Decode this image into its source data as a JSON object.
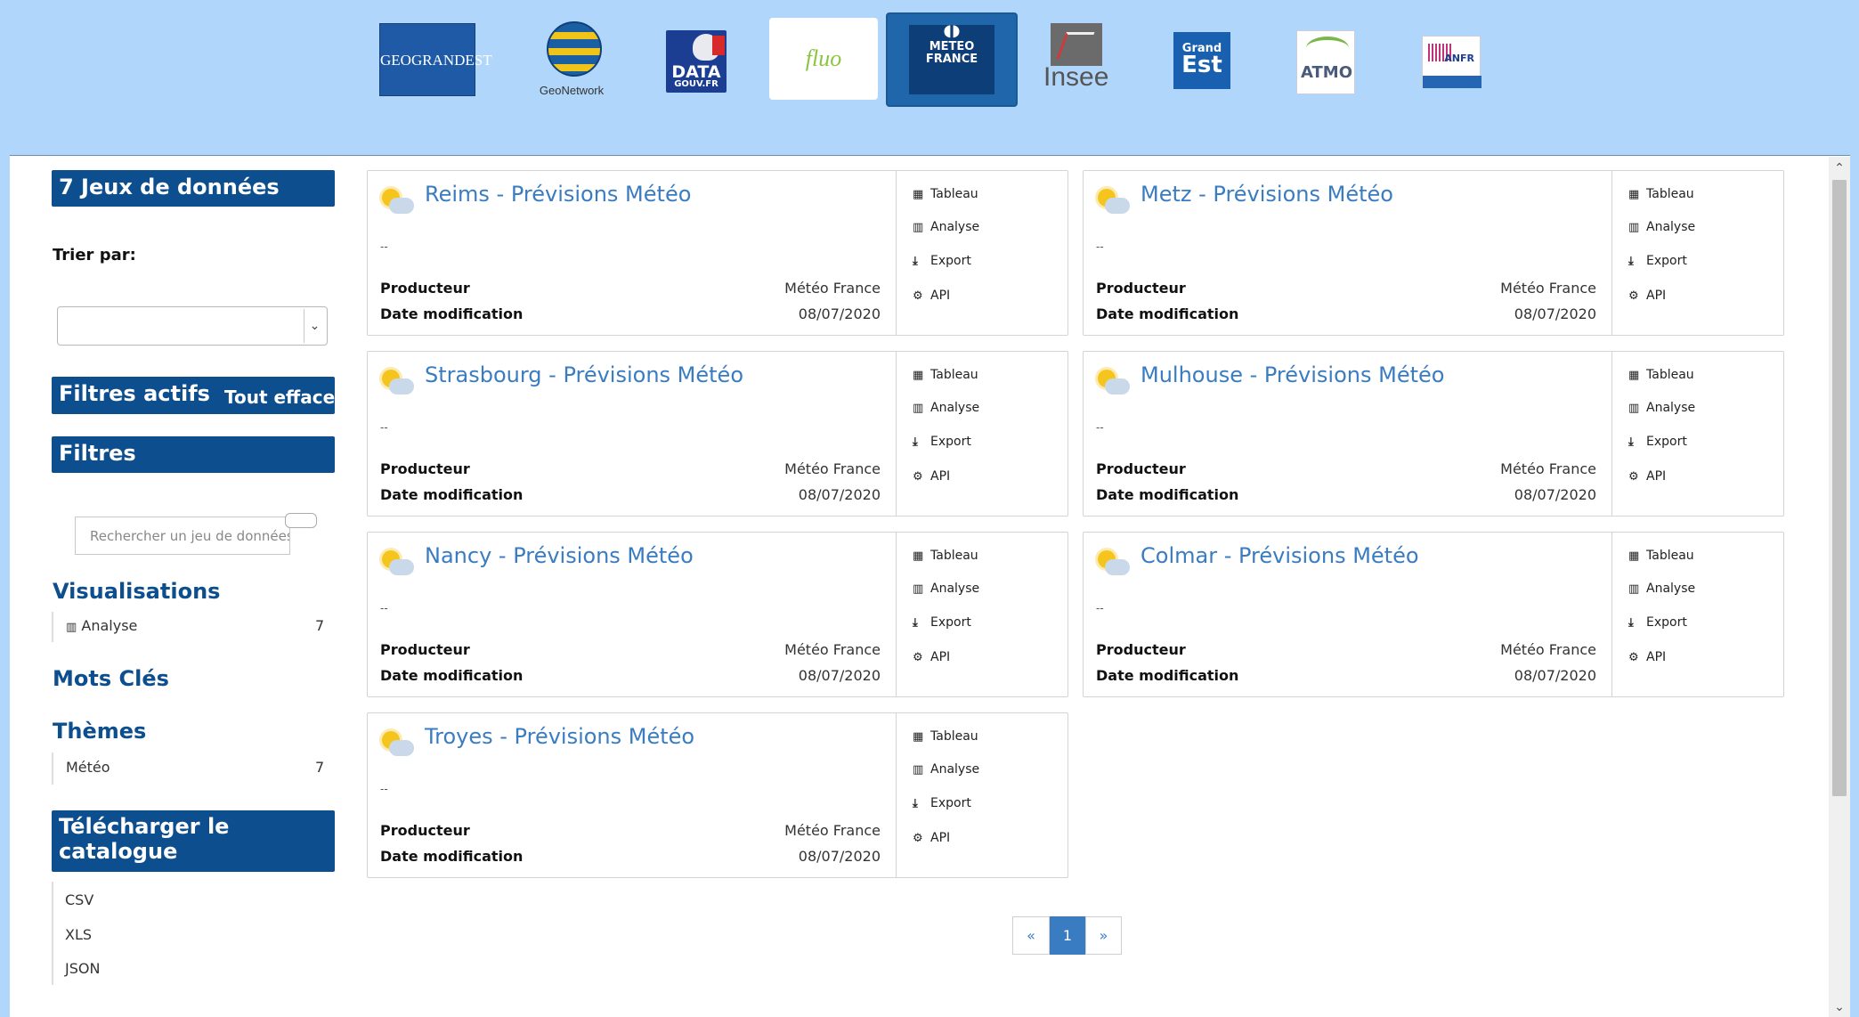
{
  "logos": {
    "geograndest": "GEOGRANDEST",
    "geonetwork": "GeoNetwork",
    "datagouv_top": "DATA",
    "datagouv_bottom": "GOUV.FR",
    "fluo": "fluo",
    "meteo_top": "METEO",
    "meteo_bottom": "FRANCE",
    "insee": "Insee",
    "grandest_top": "Grand",
    "grandest_bottom": "Est",
    "atmo": "ATMO",
    "anfr": "ANFR"
  },
  "sidebar": {
    "dataset_count_title": "7 Jeux de données",
    "sort_label": "Trier par:",
    "sort_value": "",
    "active_filters_title": "Filtres actifs",
    "clear_all": "Tout effacer",
    "filters_title": "Filtres",
    "search_placeholder": "Rechercher un jeu de données",
    "facets": {
      "visualisations": {
        "title": "Visualisations",
        "items": [
          {
            "label": "Analyse",
            "count": "7"
          }
        ]
      },
      "keywords": {
        "title": "Mots Clés"
      },
      "themes": {
        "title": "Thèmes",
        "items": [
          {
            "label": "Météo",
            "count": "7"
          }
        ]
      }
    },
    "download_title_line1": "Télécharger le",
    "download_title_line2": "catalogue",
    "download_formats": [
      "CSV",
      "XLS",
      "JSON"
    ]
  },
  "card_labels": {
    "producer": "Producteur",
    "date": "Date modification",
    "empty_description": "--",
    "actions": [
      "Tableau",
      "Analyse",
      "Export",
      "API"
    ]
  },
  "datasets": [
    {
      "title": "Reims - Prévisions Météo",
      "producer": "Météo France",
      "date": "08/07/2020"
    },
    {
      "title": "Metz - Prévisions Météo",
      "producer": "Météo France",
      "date": "08/07/2020"
    },
    {
      "title": "Strasbourg - Prévisions Météo",
      "producer": "Météo France",
      "date": "08/07/2020"
    },
    {
      "title": "Mulhouse - Prévisions Météo",
      "producer": "Météo France",
      "date": "08/07/2020"
    },
    {
      "title": "Nancy - Prévisions Météo",
      "producer": "Météo France",
      "date": "08/07/2020"
    },
    {
      "title": "Colmar - Prévisions Météo",
      "producer": "Météo France",
      "date": "08/07/2020"
    },
    {
      "title": "Troyes - Prévisions Météo",
      "producer": "Météo France",
      "date": "08/07/2020"
    }
  ],
  "pagination": {
    "prev": "«",
    "current": "1",
    "next": "»"
  },
  "colors": {
    "brand_dark": "#0d4e8e",
    "link": "#3a7cc1",
    "header_band": "#b0d6fb"
  },
  "icons": {
    "tableau": "table-icon",
    "analyse": "bar-chart-icon",
    "export": "download-icon",
    "api": "cogs-icon",
    "dataset": "weather-sun-cloud-icon"
  }
}
